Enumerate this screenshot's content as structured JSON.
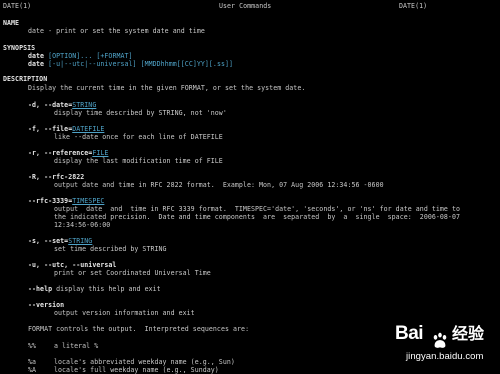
{
  "header": {
    "left": "DATE(1)",
    "center": "User Commands",
    "right": "DATE(1)"
  },
  "sections": {
    "name_heading": "NAME",
    "name_text": "date - print or set the system date and time",
    "synopsis_heading": "SYNOPSIS",
    "synopsis_line1": {
      "cmd": "date",
      "args": "[OPTION]... [+FORMAT]"
    },
    "synopsis_line2": {
      "cmd": "date",
      "args": "[-u|--utc|--universal] [MMDDhhmm[[CC]YY][.ss]]"
    },
    "description_heading": "DESCRIPTION",
    "description_text": "Display the current time in the given FORMAT, or set the system date."
  },
  "options": [
    {
      "flag": "-d, --date=",
      "arg": "STRING",
      "desc": [
        "display time described by STRING, not 'now'"
      ]
    },
    {
      "flag": "-f, --file=",
      "arg": "DATEFILE",
      "desc": [
        "like --date once for each line of DATEFILE"
      ]
    },
    {
      "flag": "-r, --reference=",
      "arg": "FILE",
      "desc": [
        "display the last modification time of FILE"
      ]
    },
    {
      "flag": "-R, --rfc-2822",
      "arg": "",
      "desc": [
        "output date and time in RFC 2822 format.  Example: Mon, 07 Aug 2006 12:34:56 -0600"
      ]
    },
    {
      "flag": "--rfc-3339=",
      "arg": "TIMESPEC",
      "desc": [
        "output  date  and  time in RFC 3339 format.  TIMESPEC='date', 'seconds', or 'ns' for date and time to",
        "the indicated precision.  Date and time components  are  separated  by  a  single  space:  2006-08-07",
        "12:34:56-06:00"
      ]
    },
    {
      "flag": "-s, --set=",
      "arg": "STRING",
      "desc": [
        "set time described by STRING"
      ]
    },
    {
      "flag": "-u, --utc, --universal",
      "arg": "",
      "desc": [
        "print or set Coordinated Universal Time"
      ]
    },
    {
      "flag": "--help",
      "arg": "",
      "desc": [
        "display this help and exit"
      ]
    },
    {
      "flag": "--version",
      "arg": "",
      "desc": [
        "output version information and exit"
      ]
    }
  ],
  "format_intro": "FORMAT controls the output.  Interpreted sequences are:",
  "sequences": [
    {
      "code": "%%",
      "desc": "a literal %"
    },
    {
      "code": "%a",
      "desc": "locale's abbreviated weekday name (e.g., Sun)"
    },
    {
      "code": "%A",
      "desc": "locale's full weekday name (e.g., Sunday)"
    }
  ],
  "watermark": {
    "logo": "Bai",
    "logo_suffix": "经验",
    "url": "jingyan.baidu.com"
  }
}
